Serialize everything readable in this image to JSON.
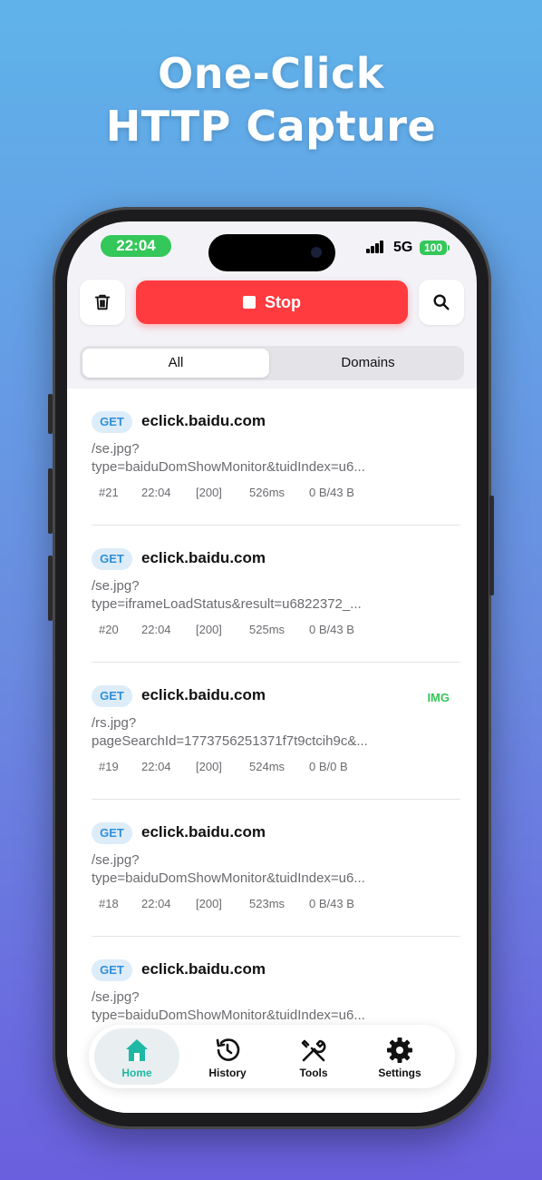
{
  "promo": {
    "line1": "One-Click",
    "line2": "HTTP Capture"
  },
  "status_bar": {
    "time": "22:04",
    "network": "5G",
    "battery": "100"
  },
  "toolbar": {
    "stop_label": "Stop",
    "delete_icon": "trash-icon",
    "search_icon": "search-icon"
  },
  "segment": {
    "all": "All",
    "domains": "Domains",
    "selected": "All"
  },
  "requests": [
    {
      "method": "GET",
      "host": "eclick.baidu.com",
      "path": "/se.jpg?\ntype=baiduDomShowMonitor&tuidIndex=u6...",
      "index": "#21",
      "time": "22:04",
      "status": "[200]",
      "duration": "526ms",
      "size": "0 B/43 B",
      "tag": ""
    },
    {
      "method": "GET",
      "host": "eclick.baidu.com",
      "path": "/se.jpg?\ntype=iframeLoadStatus&result=u6822372_...",
      "index": "#20",
      "time": "22:04",
      "status": "[200]",
      "duration": "525ms",
      "size": "0 B/43 B",
      "tag": ""
    },
    {
      "method": "GET",
      "host": "eclick.baidu.com",
      "path": "/rs.jpg?\npageSearchId=1773756251371f7t9ctcih9c&...",
      "index": "#19",
      "time": "22:04",
      "status": "[200]",
      "duration": "524ms",
      "size": "0 B/0 B",
      "tag": "IMG"
    },
    {
      "method": "GET",
      "host": "eclick.baidu.com",
      "path": "/se.jpg?\ntype=baiduDomShowMonitor&tuidIndex=u6...",
      "index": "#18",
      "time": "22:04",
      "status": "[200]",
      "duration": "523ms",
      "size": "0 B/43 B",
      "tag": ""
    },
    {
      "method": "GET",
      "host": "eclick.baidu.com",
      "path": "/se.jpg?\ntype=baiduDomShowMonitor&tuidIndex=u6...",
      "index": "",
      "time": "",
      "status": "",
      "duration": "",
      "size": "",
      "tag": ""
    }
  ],
  "tabs": [
    {
      "label": "Home",
      "icon": "home-icon",
      "active": true
    },
    {
      "label": "History",
      "icon": "history-icon",
      "active": false
    },
    {
      "label": "Tools",
      "icon": "tools-icon",
      "active": false
    },
    {
      "label": "Settings",
      "icon": "gear-icon",
      "active": false
    }
  ],
  "colors": {
    "stop": "#ff3b3f",
    "active_tab": "#1fb8a4",
    "method_text": "#2f8fd8",
    "tag_img": "#34c759",
    "time_pill": "#34c759"
  }
}
